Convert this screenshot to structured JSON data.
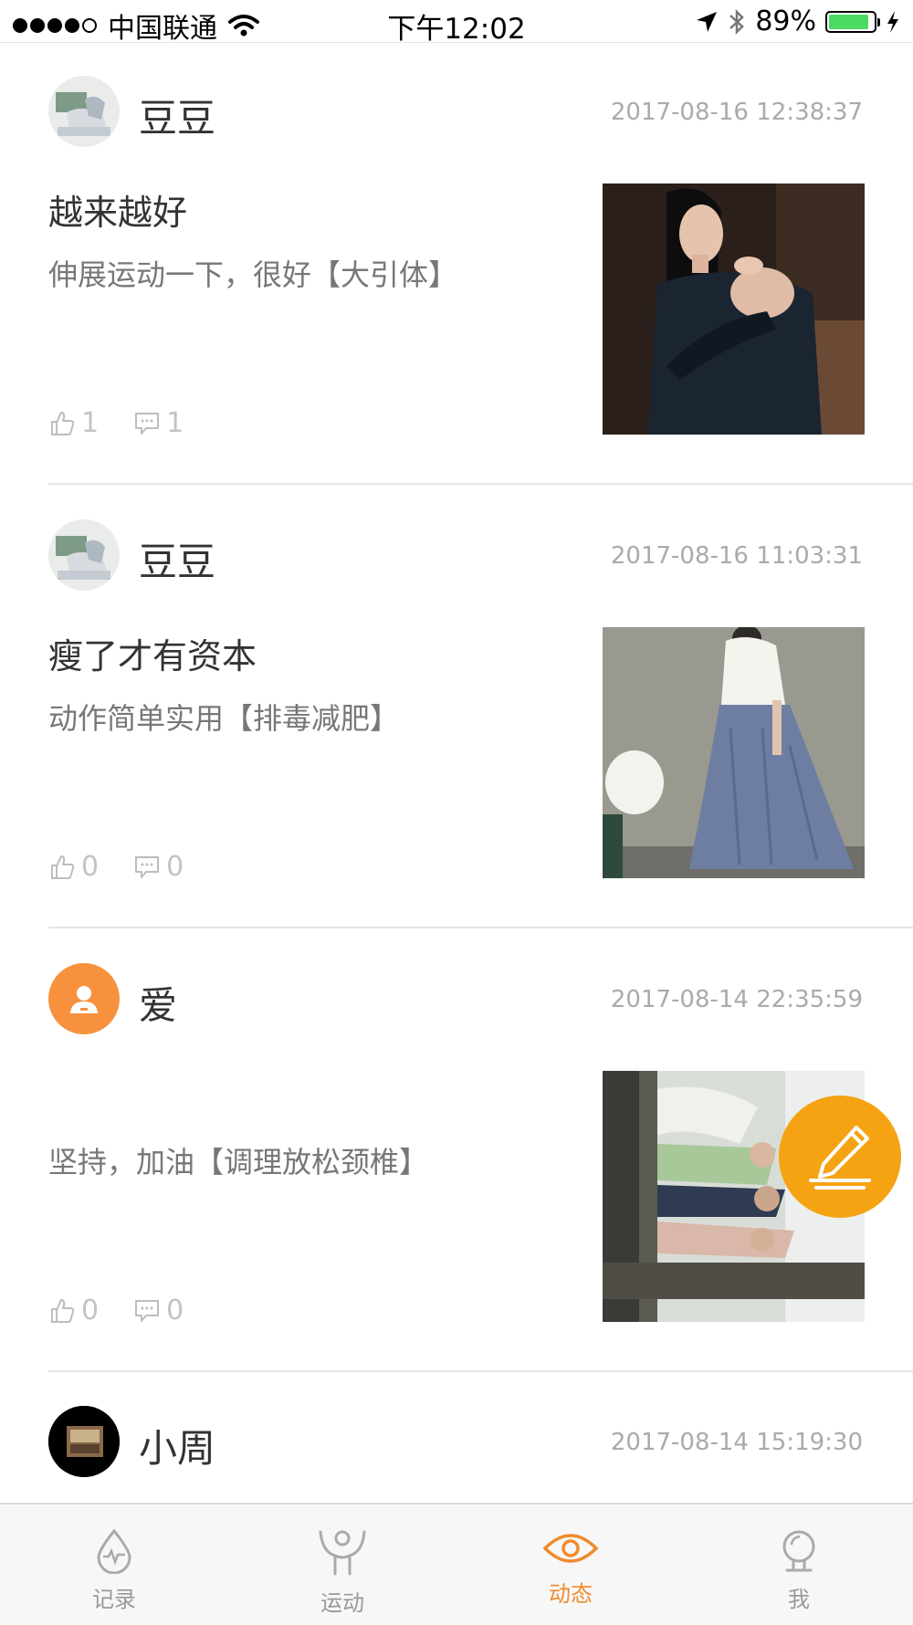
{
  "status_bar": {
    "carrier": "中国联通",
    "time": "下午12:02",
    "battery": "89%",
    "battery_level": 0.89
  },
  "posts": [
    {
      "name": "豆豆",
      "time": "2017-08-16 12:38:37",
      "title": "越来越好",
      "desc": "伸展运动一下，很好【大引体】",
      "likes": "1",
      "comments": "1"
    },
    {
      "name": "豆豆",
      "time": "2017-08-16 11:03:31",
      "title": "瘦了才有资本",
      "desc": "动作简单实用【排毒减肥】",
      "likes": "0",
      "comments": "0"
    },
    {
      "name": "爱",
      "time": "2017-08-14 22:35:59",
      "title": "",
      "desc": "坚持，加油【调理放松颈椎】",
      "likes": "0",
      "comments": "0"
    },
    {
      "name": "小周",
      "time": "2017-08-14 15:19:30"
    }
  ],
  "tabs": [
    {
      "label": "记录",
      "icon": "record-icon"
    },
    {
      "label": "运动",
      "icon": "exercise-icon"
    },
    {
      "label": "动态",
      "icon": "eye-icon",
      "active": true
    },
    {
      "label": "我",
      "icon": "profile-icon"
    }
  ],
  "colors": {
    "accent": "#f08b2c",
    "fab": "#f5a312",
    "avatar_default": "#f7913d"
  }
}
